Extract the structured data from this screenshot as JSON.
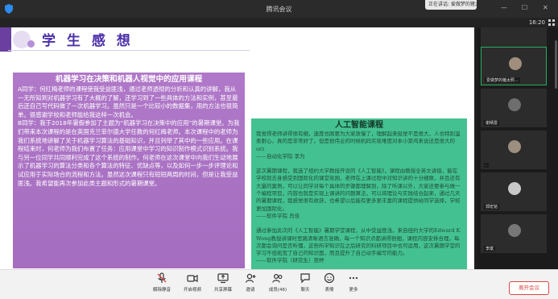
{
  "window": {
    "title": "腾讯会议",
    "notice": "正在讲话: 爱做梦的猪太照...",
    "time": "16:20"
  },
  "slide": {
    "heading": "学 生 感 想",
    "purple_box": {
      "title": "机器学习在决策和机器人视觉中的应用课程",
      "p1": "A同学：何红梅老师的课程使我受益匪浅，通过老师透彻的分析和认真的讲解，我从一无所知到对机器学习有了大概的了解，还学习到了一些具体的方法和实例，甚至最后还自己写代码做了一次机器学习。虽然只是一个比较小的数据集，用的方法也很简单。很感谢学校和老师能给我这样一次机会。",
      "p2": "B同学：我于2018年暑假参加了主题为“机器学习在决策中的应用”的暑期课堂。为我们带来本次课程的是在英国克兰菲尔德大学任教的何红梅老师。本次课程中的老师为我们系统地讲解了关于机器学习算法的基础知识，并且列举了其中的一些应用。在课程结束时，何老师为我们布置了任务：应用课堂中学习的知识制作模式识别系统。我与另一位同学共同顺利完成了这个系统的制作。何老师在这次课堂中向我们生动地展示了机器学习的算法分类和各个算法的特征、优缺点等，以及如何一步一步评理论和试应用于实际场合的流程和方法。虽然这次课程只有短短两周的时间，但是让我受益匪浅。我希望能再次参加此类主题和形式的暑期课堂。"
    },
    "green_box": {
      "title": "人工智能课程",
      "p1": "我觉得老师讲得很有细，速度也刚要为大家放慢了，理解起来挺觉不是很大，人也特别温柔耐心，真的是非常好了。但是很伟业的时候机码实现难度对本小菜鸡来说还是很大的orz\n——自动化学院 李为",
      "p2": "这次暑期课程，我选了纽约大学教授开设的《人工智能》，课程由教授全英文讲授，能在学校就去身感受到国际化的课堂氛围，老师在上课过程中对知识讲的十分细致，并且还有大量的案例，可以让同学对每个具体的步骤都理解到，除了听课以外，大家还要参与做一个编程项目，内容也就是实现上课讲的问题算法，可以将理论与实践结合起来，通过几天的暑期课程，我感觉很有收获，也希望以后能有更多更丰富的课程提供给同学选择，学校更加国际化。\n——软件学院 肖佳",
      "p3": "通过参加此次的《人工智能》暑期学堂课程，从中受益匪浅，来自纽约大学的Edward K Wong教授讲课时思路清晰语言准确，每一个知识点都讲得很细，课程内容安排合理，每次都会询问是否听懂，这些所学知识在之后研究的科研项目中也可运用，这次暑期学堂的学习不但拓宽了自己的知识面，而且提升了自己动手编写的能力。\n——软件学院（研究生）贾婷"
    }
  },
  "participants": [
    {
      "name": "",
      "active": false
    },
    {
      "name": "爱做梦的猪太照...",
      "active": true
    },
    {
      "name": "谢晴雷",
      "active": false
    },
    {
      "name": ".",
      "active": false
    },
    {
      "name": "郭宏铭",
      "active": false
    },
    {
      "name": "李斌",
      "active": false
    }
  ],
  "toolbar": {
    "mute": "解除静音",
    "video": "开启视频",
    "share": "共享屏幕",
    "invite": "邀请",
    "members": "成员(46)",
    "chat": "聊天",
    "react": "表情",
    "more": "更多",
    "leave": "离开会议"
  },
  "colors": {
    "heading": "#4b2fa8",
    "purple": "#a56dbf",
    "green": "#44c190",
    "leave": "#e04545",
    "active_border": "#27ae60"
  },
  "icons": [
    "shield-icon",
    "grid-icon",
    "mic-off-icon",
    "video-icon",
    "share-icon",
    "invite-icon",
    "members-icon",
    "chat-icon",
    "emoji-icon",
    "more-icon"
  ]
}
